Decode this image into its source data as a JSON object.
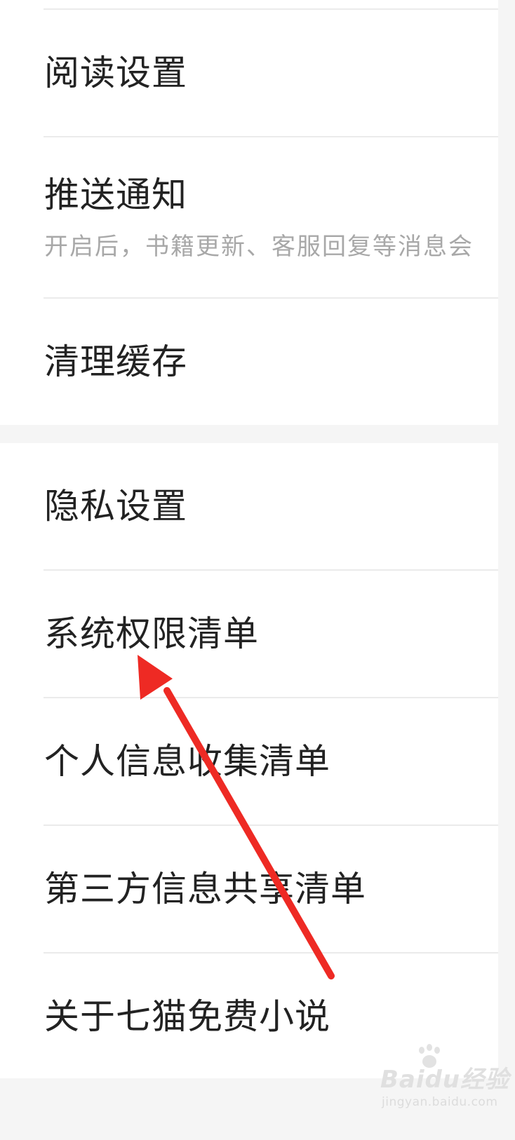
{
  "settings": {
    "group1": [
      {
        "title": "阅读设置",
        "subtitle": ""
      },
      {
        "title": "推送通知",
        "subtitle": "开启后，书籍更新、客服回复等消息会"
      },
      {
        "title": "清理缓存",
        "subtitle": ""
      }
    ],
    "group2": [
      {
        "title": "隐私设置"
      },
      {
        "title": "系统权限清单"
      },
      {
        "title": "个人信息收集清单"
      },
      {
        "title": "第三方信息共享清单"
      },
      {
        "title": "关于七猫免费小说"
      }
    ]
  },
  "annotation": {
    "arrow_color": "#ee2a24"
  },
  "watermark": {
    "brand": "Baidu经验",
    "url": "jingyan.baidu.com"
  }
}
